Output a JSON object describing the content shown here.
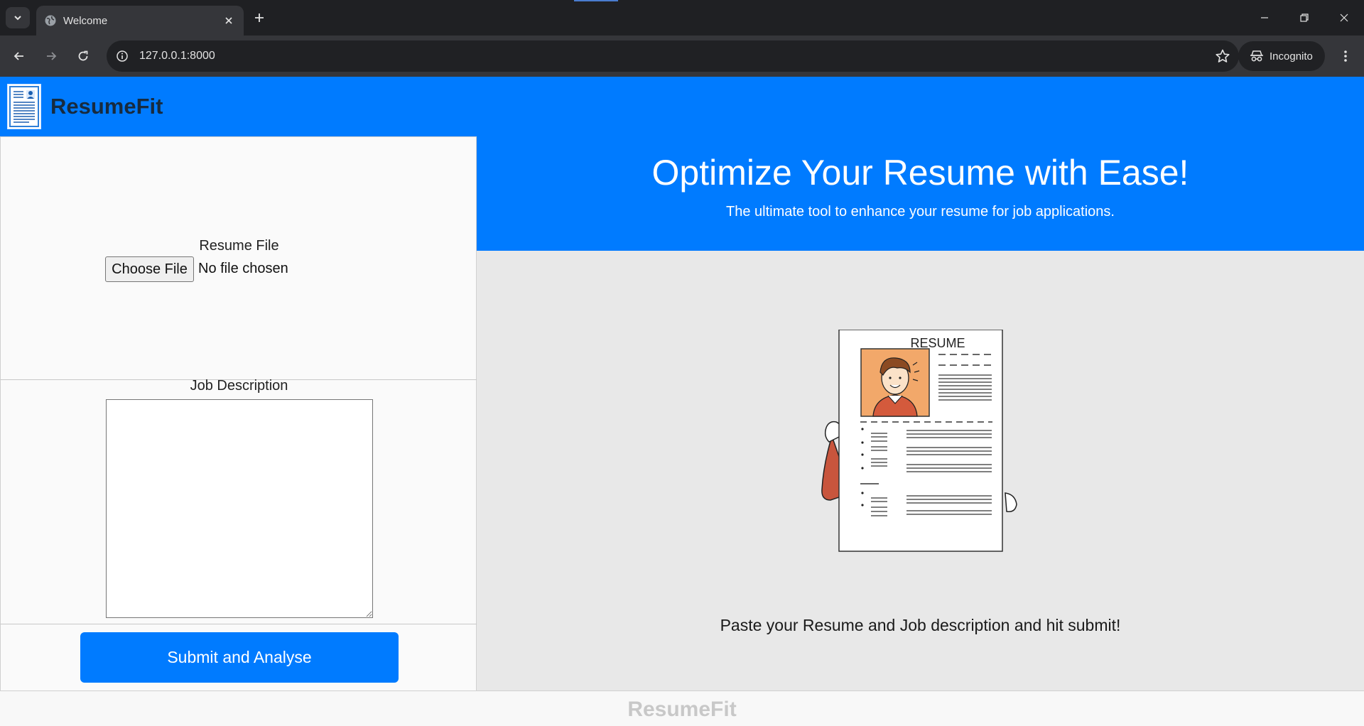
{
  "browser": {
    "tab_title": "Welcome",
    "url": "127.0.0.1:8000",
    "incognito_label": "Incognito"
  },
  "header": {
    "brand": "ResumeFit"
  },
  "upload": {
    "resume_file_label": "Resume File",
    "choose_file_label": "Choose File",
    "file_status": "No file chosen"
  },
  "job": {
    "label": "Job Description",
    "value": ""
  },
  "submit": {
    "label": "Submit and Analyse"
  },
  "hero": {
    "title": "Optimize Your Resume with Ease!",
    "subtitle": "The ultimate tool to enhance your resume for job applications."
  },
  "illustration": {
    "heading": "RESUME"
  },
  "instructions": "Paste your Resume and Job description and hit submit!",
  "footer": {
    "brand": "ResumeFit"
  },
  "colors": {
    "primary": "#007bff",
    "brand_text": "#172b3f",
    "panel_bg": "#e8e8e8"
  }
}
